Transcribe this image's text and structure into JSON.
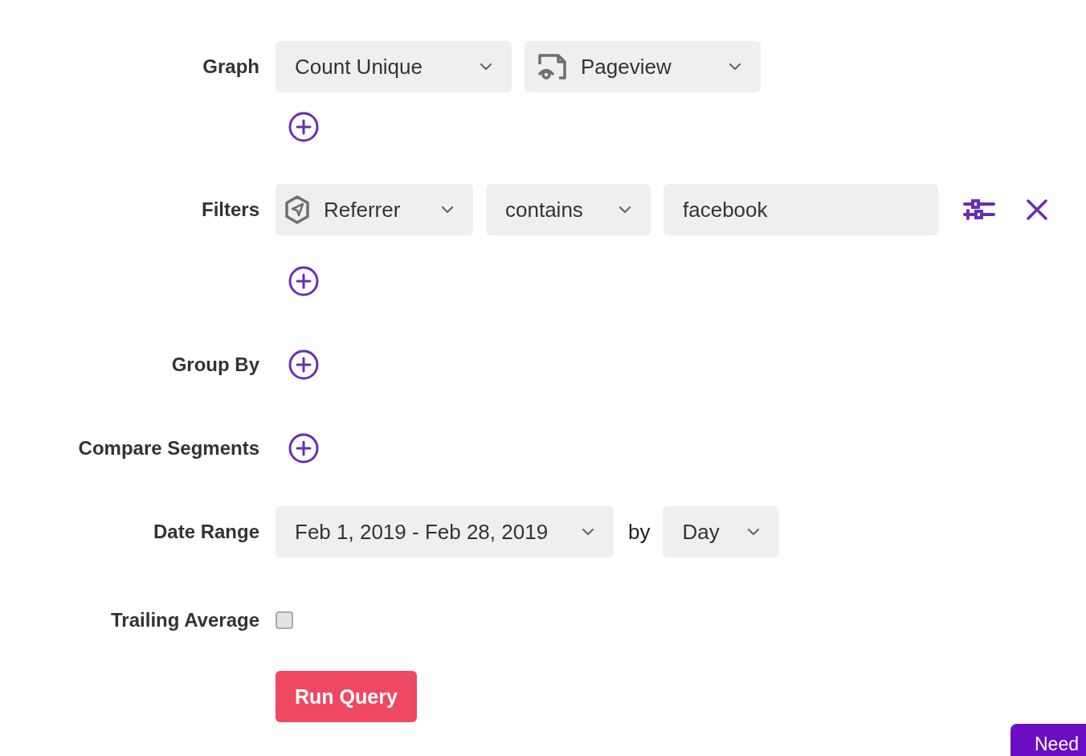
{
  "graph": {
    "label": "Graph",
    "selectors": [
      {
        "kind": "plain",
        "value": "Count Unique"
      },
      {
        "kind": "event",
        "value": "Pageview"
      }
    ]
  },
  "filters": {
    "label": "Filters",
    "rows": [
      {
        "property": "Referrer",
        "operator": "contains",
        "value": "facebook"
      }
    ]
  },
  "group_by": {
    "label": "Group By"
  },
  "compare_segments": {
    "label": "Compare Segments"
  },
  "date_range": {
    "label": "Date Range",
    "value": "Feb 1, 2019 - Feb 28, 2019",
    "by_label": "by",
    "interval": "Day"
  },
  "trailing_average": {
    "label": "Trailing Average",
    "checked": false
  },
  "run_button": "Run Query",
  "help_button": "Need"
}
